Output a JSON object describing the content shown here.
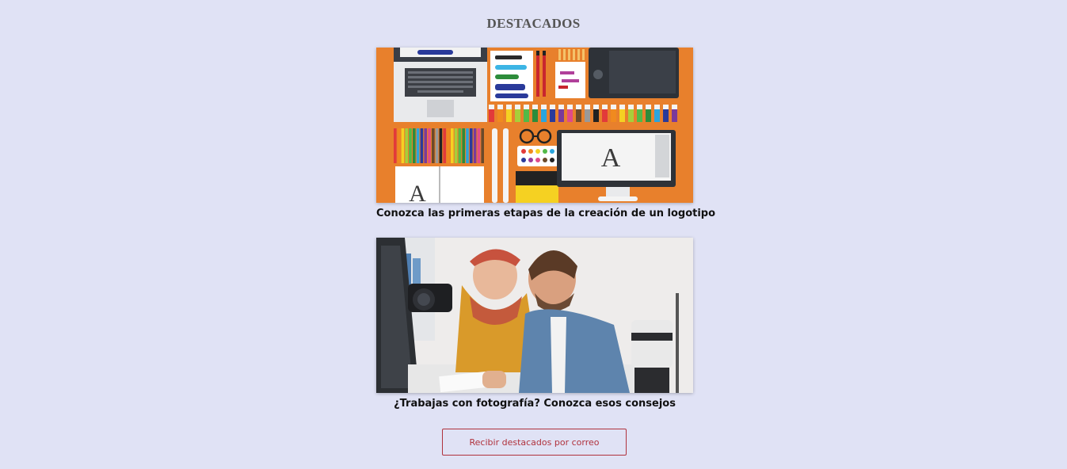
{
  "section": {
    "title": "DESTACADOS"
  },
  "posts": [
    {
      "title": "Conozca las primeras etapas de la creación de un logotipo",
      "image_icon": "design-tools-illustration"
    },
    {
      "title": "¿Trabajas con fotografía? Conozca esos consejos",
      "image_icon": "photographers-photo"
    }
  ],
  "subscribe": {
    "label": "Recibir destacados por correo",
    "color": "#b0323d"
  },
  "colors": {
    "background": "#e0e2f5",
    "illustration_bg": "#e8802c"
  }
}
